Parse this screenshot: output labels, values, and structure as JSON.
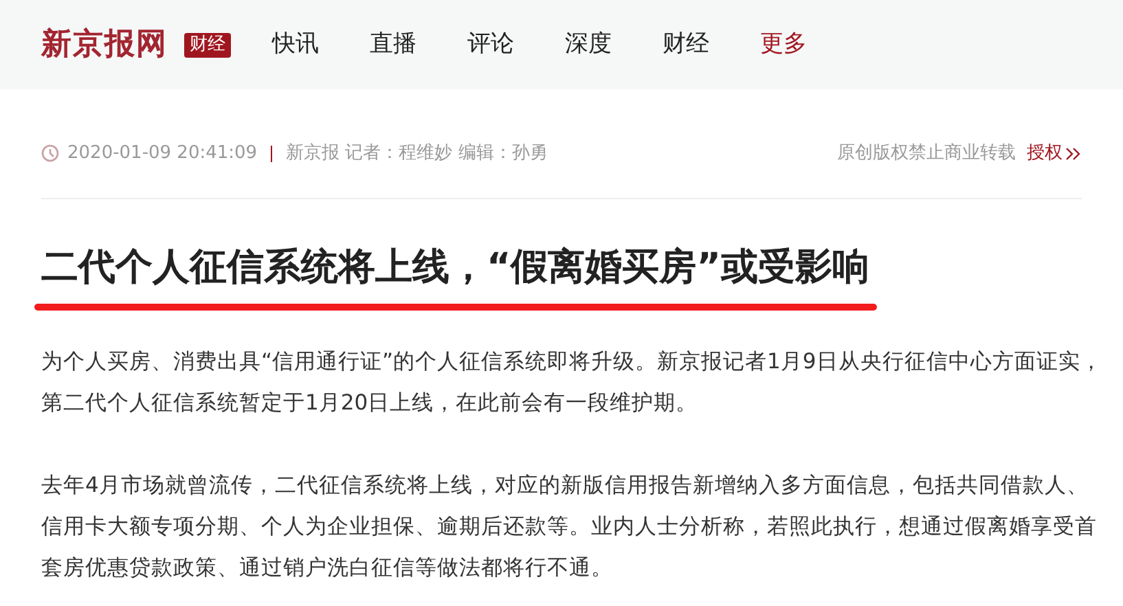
{
  "header": {
    "logo": "新京报网",
    "channel_badge": "财经",
    "nav": [
      {
        "label": "快讯",
        "kind": "link"
      },
      {
        "label": "直播",
        "kind": "link"
      },
      {
        "label": "评论",
        "kind": "link"
      },
      {
        "label": "深度",
        "kind": "link"
      },
      {
        "label": "财经",
        "kind": "link"
      },
      {
        "label": "更多",
        "kind": "more"
      }
    ]
  },
  "meta": {
    "datetime": "2020-01-09 20:41:09",
    "byline": "新京报 记者：程维妙 编辑：孙勇",
    "copyright": "原创版权禁止商业转载",
    "license_link": "授权"
  },
  "article": {
    "title": "二代个人征信系统将上线，“假离婚买房”或受影响",
    "paragraphs": [
      "为个人买房、消费出具“信用通行证”的个人征信系统即将升级。新京报记者1月9日从央行征信中心方面证实，第二代个人征信系统暂定于1月20日上线，在此前会有一段维护期。",
      "去年4月市场就曾流传，二代征信系统将上线，对应的新版信用报告新增纳入多方面信息，包括共同借款人、信用卡大额专项分期、个人为企业担保、逾期后还款等。业内人士分析称，若照此执行，想通过假离婚享受首套房优惠贷款政策、通过销户洗白征信等做法都将行不通。"
    ]
  }
}
